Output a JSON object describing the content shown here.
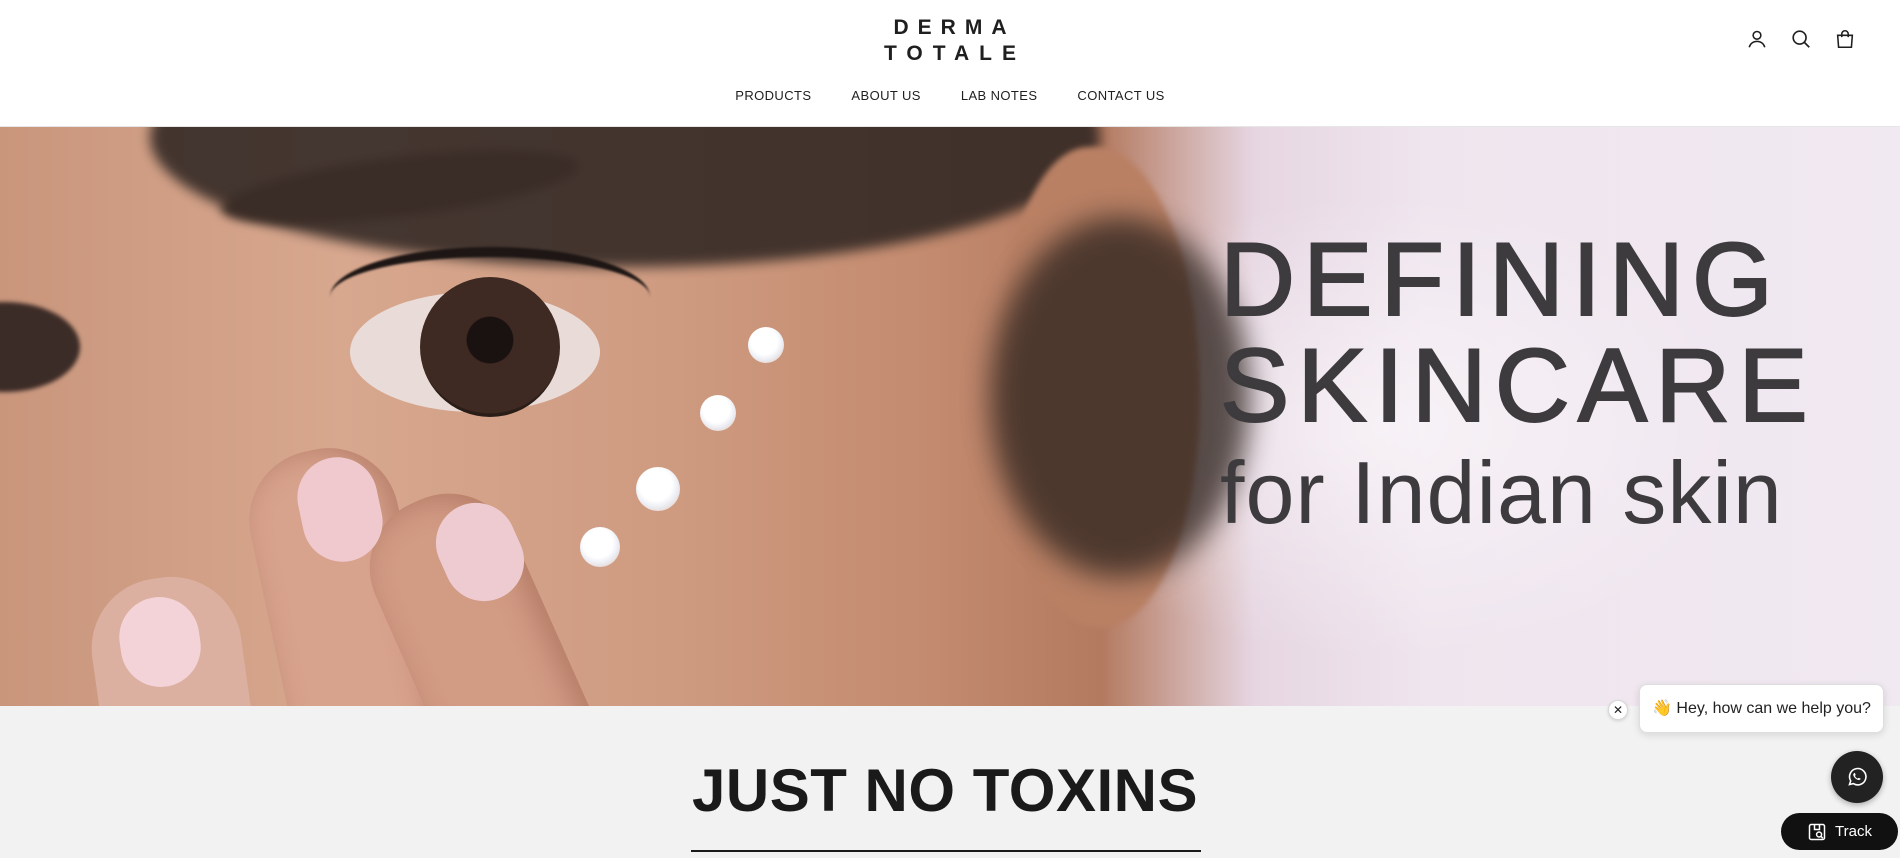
{
  "brand": {
    "logo_line1": "DERMA",
    "logo_line2": "TOTALE"
  },
  "nav": {
    "items": [
      "PRODUCTS",
      "ABOUT US",
      "LAB NOTES",
      "CONTACT US"
    ]
  },
  "header_icons": [
    "account-icon",
    "search-icon",
    "shopping-bag-icon"
  ],
  "hero": {
    "line1": "DEFINING",
    "line2": "SKINCARE",
    "line3": "for Indian skin",
    "text_color": "#3d3b3d"
  },
  "section": {
    "title": "JUST NO TOXINS",
    "background": "#f2f2f2"
  },
  "chat": {
    "bubble_text": "👋 Hey, how can we help you?",
    "close_glyph": "✕"
  },
  "track": {
    "label": "Track"
  }
}
